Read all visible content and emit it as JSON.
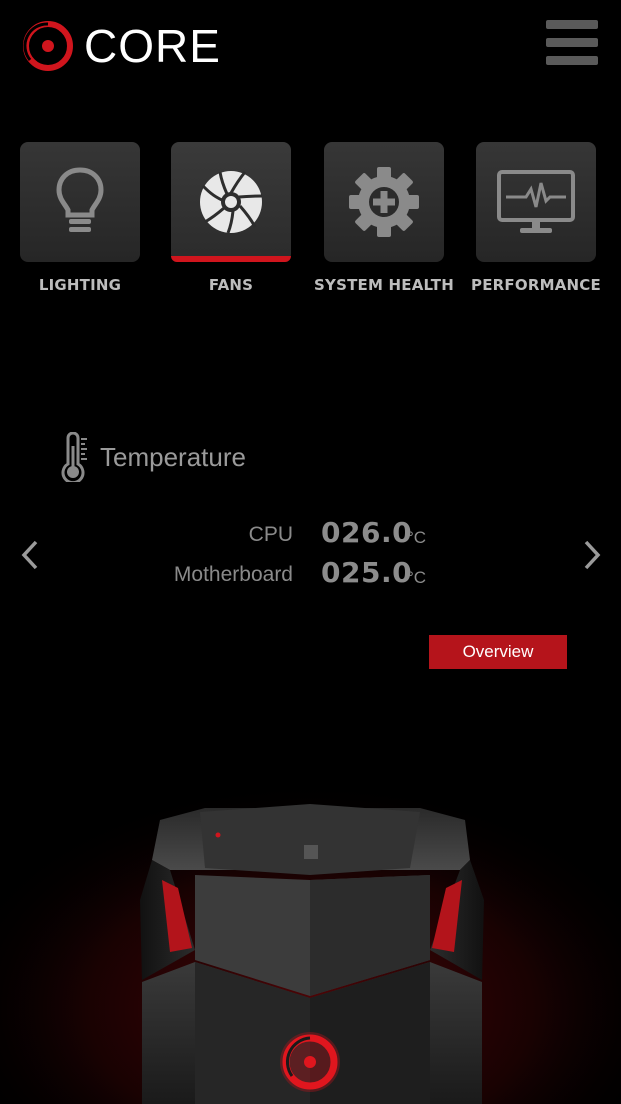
{
  "header": {
    "logo_text": "CORE",
    "menu_icon": "hamburger-icon"
  },
  "tabs": [
    {
      "label": "LIGHTING",
      "icon": "lightbulb-icon",
      "active": false
    },
    {
      "label": "FANS",
      "icon": "fan-icon",
      "active": true
    },
    {
      "label": "SYSTEM HEALTH",
      "icon": "gear-plus-icon",
      "active": false
    },
    {
      "label": "PERFORMANCE",
      "icon": "monitor-pulse-icon",
      "active": false
    }
  ],
  "temperature": {
    "title": "Temperature",
    "icon": "thermometer-icon",
    "readings": [
      {
        "label": "CPU",
        "value": "026.0",
        "unit": "°C"
      },
      {
        "label": "Motherboard",
        "value": "025.0",
        "unit": "°C"
      }
    ],
    "prev_icon": "chevron-left-icon",
    "next_icon": "chevron-right-icon"
  },
  "overview_button": {
    "label": "Overview"
  },
  "colors": {
    "accent": "#c8151c",
    "background": "#000000",
    "tab_bg": "#2e2e2e",
    "text_muted": "#8c8c8c"
  }
}
